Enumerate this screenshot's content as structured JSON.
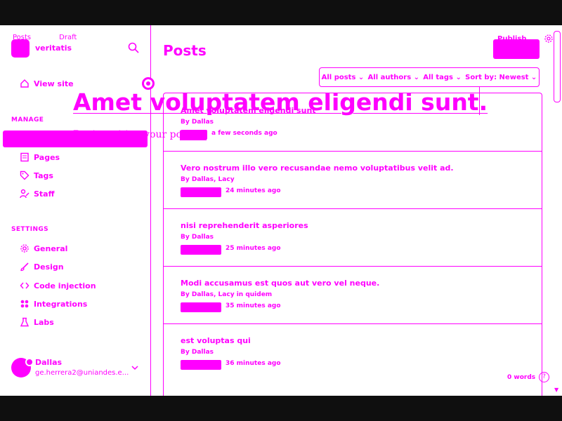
{
  "editor_tabs": [
    "Posts",
    "Draft"
  ],
  "sidebar": {
    "brand": "veritatis",
    "view_site": "View site",
    "manage_label": "MANAGE",
    "manage_items": [
      "Pages",
      "Tags",
      "Staff"
    ],
    "settings_label": "SETTINGS",
    "settings_items": [
      "General",
      "Design",
      "Code injection",
      "Integrations",
      "Labs"
    ],
    "user": {
      "name": "Dallas",
      "email": "ge.herrera2@uniandes.e..."
    }
  },
  "main": {
    "title": "Posts",
    "publish_label": "Publish",
    "filters": [
      "All posts",
      "All authors",
      "All tags",
      "Sort by: Newest"
    ],
    "posts": [
      {
        "title": "Amet voluptatem eligendi sunt",
        "meta": "By Dallas",
        "time": "a few seconds ago"
      },
      {
        "title": "Vero nostrum illo vero recusandae nemo voluptatibus velit ad.",
        "meta": "By Dallas, Lacy",
        "time": "24 minutes ago"
      },
      {
        "title": "nisi reprehenderit asperiores",
        "meta": "By Dallas",
        "time": "25 minutes ago"
      },
      {
        "title": "Modi accusamus est quos aut vero vel neque.",
        "meta": "By Dallas, Lacy in quidem",
        "time": "35 minutes ago"
      },
      {
        "title": "est voluptas qui",
        "meta": "By Dallas",
        "time": "36 minutes ago"
      }
    ]
  },
  "editor": {
    "title": "Amet voluptatem eligendi sunt.",
    "placeholder": "Begin writing your post",
    "word_count": "0 words",
    "help": "?"
  },
  "colors": {
    "accent": "#ff00ff",
    "background": "#ffffff",
    "letterbox": "#0f0f0f"
  }
}
